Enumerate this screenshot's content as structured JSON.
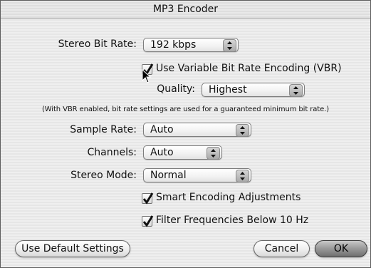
{
  "window": {
    "title": "MP3 Encoder"
  },
  "form": {
    "stereo_bit_rate": {
      "label": "Stereo Bit Rate:",
      "value": "192 kbps"
    },
    "vbr": {
      "label": "Use Variable Bit Rate Encoding (VBR)",
      "checked": true
    },
    "quality": {
      "label": "Quality:",
      "value": "Highest"
    },
    "vbr_note": "(With VBR enabled, bit rate settings are used for a guaranteed minimum bit rate.)",
    "sample_rate": {
      "label": "Sample Rate:",
      "value": "Auto"
    },
    "channels": {
      "label": "Channels:",
      "value": "Auto"
    },
    "stereo_mode": {
      "label": "Stereo Mode:",
      "value": "Normal"
    },
    "smart_encoding": {
      "label": "Smart Encoding Adjustments",
      "checked": true
    },
    "filter_frequencies": {
      "label": "Filter Frequencies Below 10 Hz",
      "checked": true
    }
  },
  "buttons": {
    "default_settings": "Use Default Settings",
    "cancel": "Cancel",
    "ok": "OK"
  },
  "icons": {
    "popup_arrows": "up-down-arrows-icon",
    "checkmark": "checkmark-icon",
    "cursor": "arrow-cursor-icon"
  }
}
